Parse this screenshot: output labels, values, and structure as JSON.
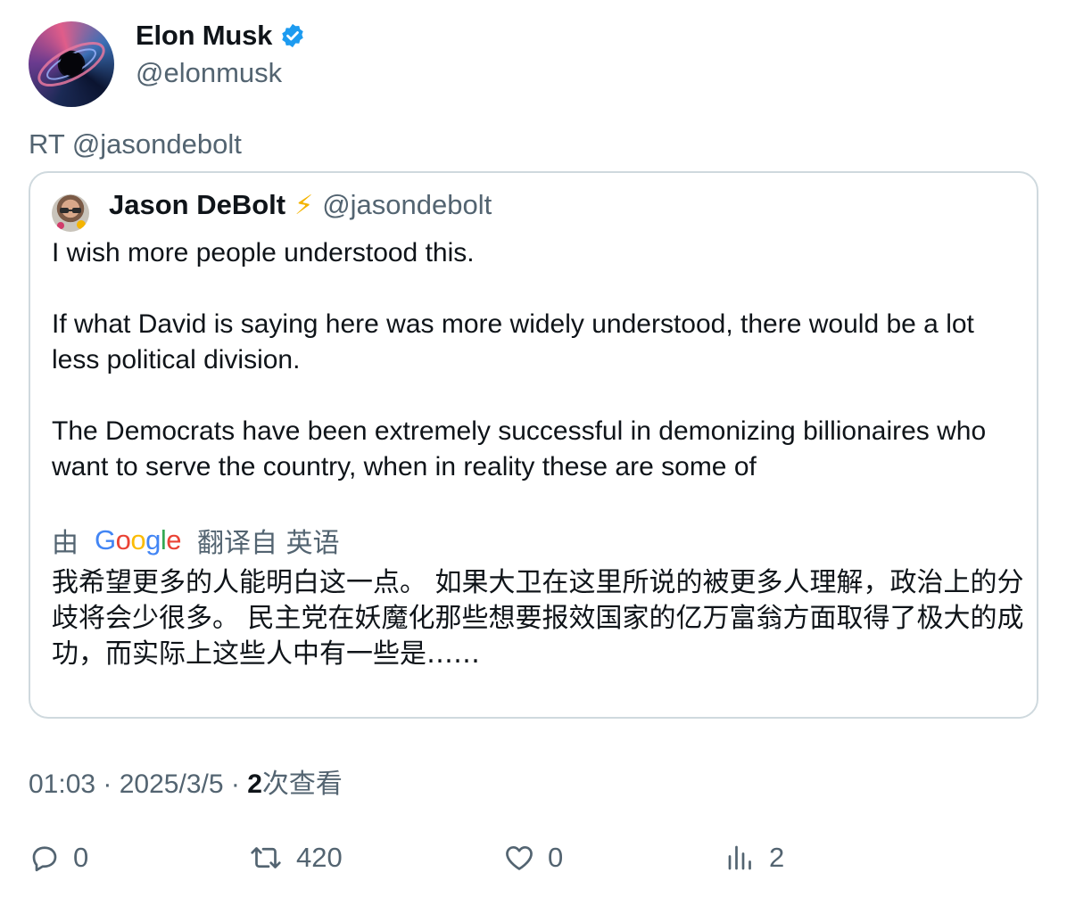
{
  "author": {
    "name": "Elon Musk",
    "handle": "@elonmusk",
    "verified_icon": "verified-badge-icon",
    "verified_color": "#1d9bf0"
  },
  "retweet_line": "RT @jasondebolt",
  "quoted": {
    "name": "Jason DeBolt",
    "emoji": "⚡",
    "handle": "@jasondebolt",
    "paragraphs": [
      "I wish more people understood this.",
      "If what David is saying here was more widely understood, there would be a lot less political division.",
      "The Democrats have been extremely successful in demonizing billionaires who want to serve the country, when in reality these are some of"
    ],
    "translate": {
      "prefix": "由",
      "brand_letters": [
        "G",
        "o",
        "o",
        "g",
        "l",
        "e"
      ],
      "suffix": "翻译自 英语"
    },
    "translated_text": "我希望更多的人能明白这一点。 如果大卫在这里所说的被更多人理解，政治上的分歧将会少很多。 民主党在妖魔化那些想要报效国家的亿万富翁方面取得了极大的成功，而实际上这些人中有一些是……"
  },
  "meta": {
    "time": "01:03",
    "sep1": " · ",
    "date": "2025/3/5",
    "sep2": " · ",
    "views_count": "2",
    "views_label": "次查看"
  },
  "actions": {
    "reply": {
      "icon": "reply-icon",
      "count": "0"
    },
    "retweet": {
      "icon": "retweet-icon",
      "count": "420"
    },
    "like": {
      "icon": "heart-icon",
      "count": "0"
    },
    "views": {
      "icon": "views-chart-icon",
      "count": "2"
    }
  },
  "colors": {
    "text": "#0f1419",
    "secondary": "#536471",
    "border": "#cfd9de"
  }
}
